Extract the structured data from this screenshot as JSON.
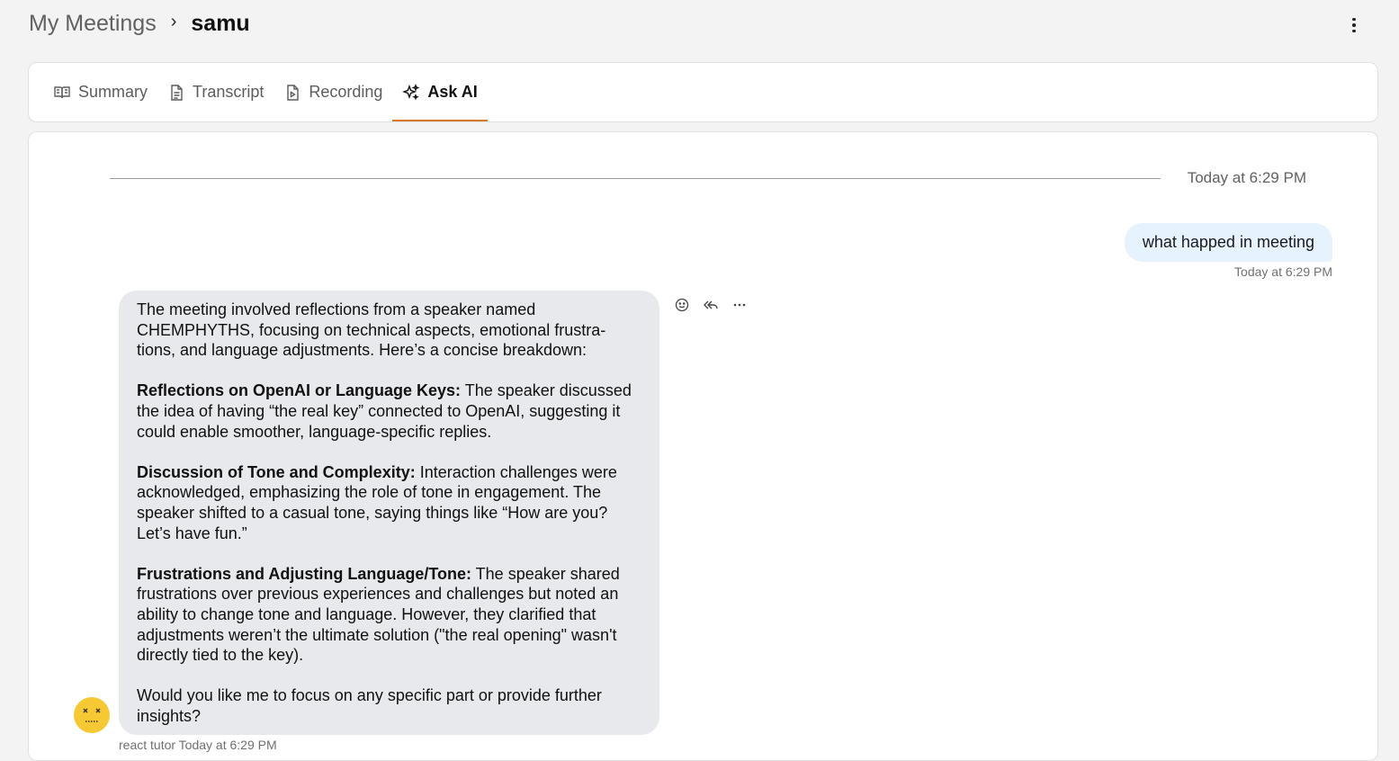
{
  "breadcrumb": {
    "root": "My Meetings",
    "separator": "›",
    "current": "samu"
  },
  "tabs": [
    {
      "label": "Summary",
      "icon": "book-open-icon",
      "active": false
    },
    {
      "label": "Transcript",
      "icon": "document-text-icon",
      "active": false
    },
    {
      "label": "Recording",
      "icon": "video-file-icon",
      "active": false
    },
    {
      "label": "Ask AI",
      "icon": "sparkle-icon",
      "active": true
    }
  ],
  "accent_color": "#d67a2a",
  "chat": {
    "divider_time": "Today at 6:29 PM",
    "user_message": {
      "text": "what happed in meeting",
      "time": "Today at 6:29 PM"
    },
    "ai_message": {
      "intro": "The meeting involved reflections from a speaker named CHEMPHYTHS, focusing on technical aspects, emotional frustra-tions, and language adjustments. Here’s a concise breakdown:",
      "sections": [
        {
          "heading": "Reflections on OpenAI or Language Keys:",
          "body": " The speaker discussed the idea of having “the real key” connected to OpenAI, suggesting it could enable smoother, language-specific replies."
        },
        {
          "heading": "Discussion of Tone and Complexity:",
          "body": " Interaction challenges were acknowledged, emphasizing the role of tone in engagement. The speaker shifted to a casual tone, saying things like “How are you? Let’s have fun.”"
        },
        {
          "heading": "Frustrations and Adjusting Language/Tone:",
          "body": " The speaker shared frustrations over previous experiences and challenges but noted an ability to change tone and language. However, they clarified that adjustments weren’t the ultimate solution (\"the real opening\" wasn't directly tied to the key)."
        }
      ],
      "closing": "Would you like me to focus on any specific part or provide further insights?",
      "sender": "react tutor",
      "time": "Today at 6:29 PM"
    }
  }
}
